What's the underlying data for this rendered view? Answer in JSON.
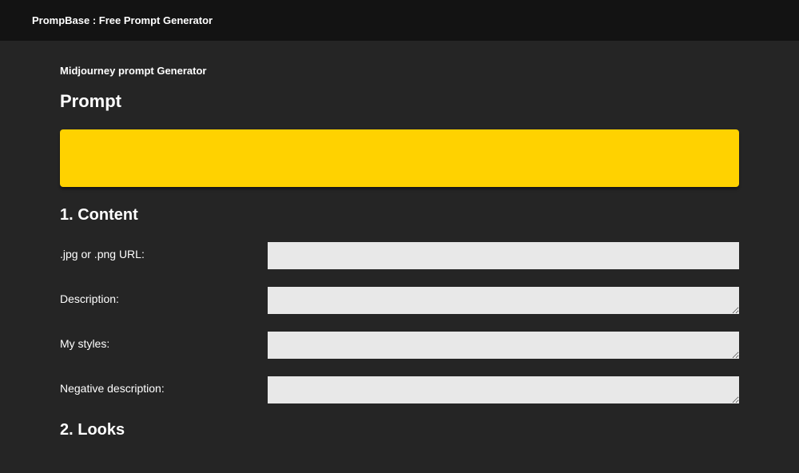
{
  "header": {
    "title": "PrompBase : Free Prompt Generator"
  },
  "page": {
    "subtitle": "Midjourney prompt Generator",
    "prompt_heading": "Prompt",
    "prompt_value": ""
  },
  "sections": {
    "content": {
      "heading": "1. Content",
      "fields": {
        "url": {
          "label": ".jpg or .png URL:",
          "value": ""
        },
        "description": {
          "label": "Description:",
          "value": ""
        },
        "my_styles": {
          "label": "My styles:",
          "value": ""
        },
        "negative_description": {
          "label": "Negative description:",
          "value": ""
        }
      }
    },
    "looks": {
      "heading": "2. Looks"
    }
  }
}
